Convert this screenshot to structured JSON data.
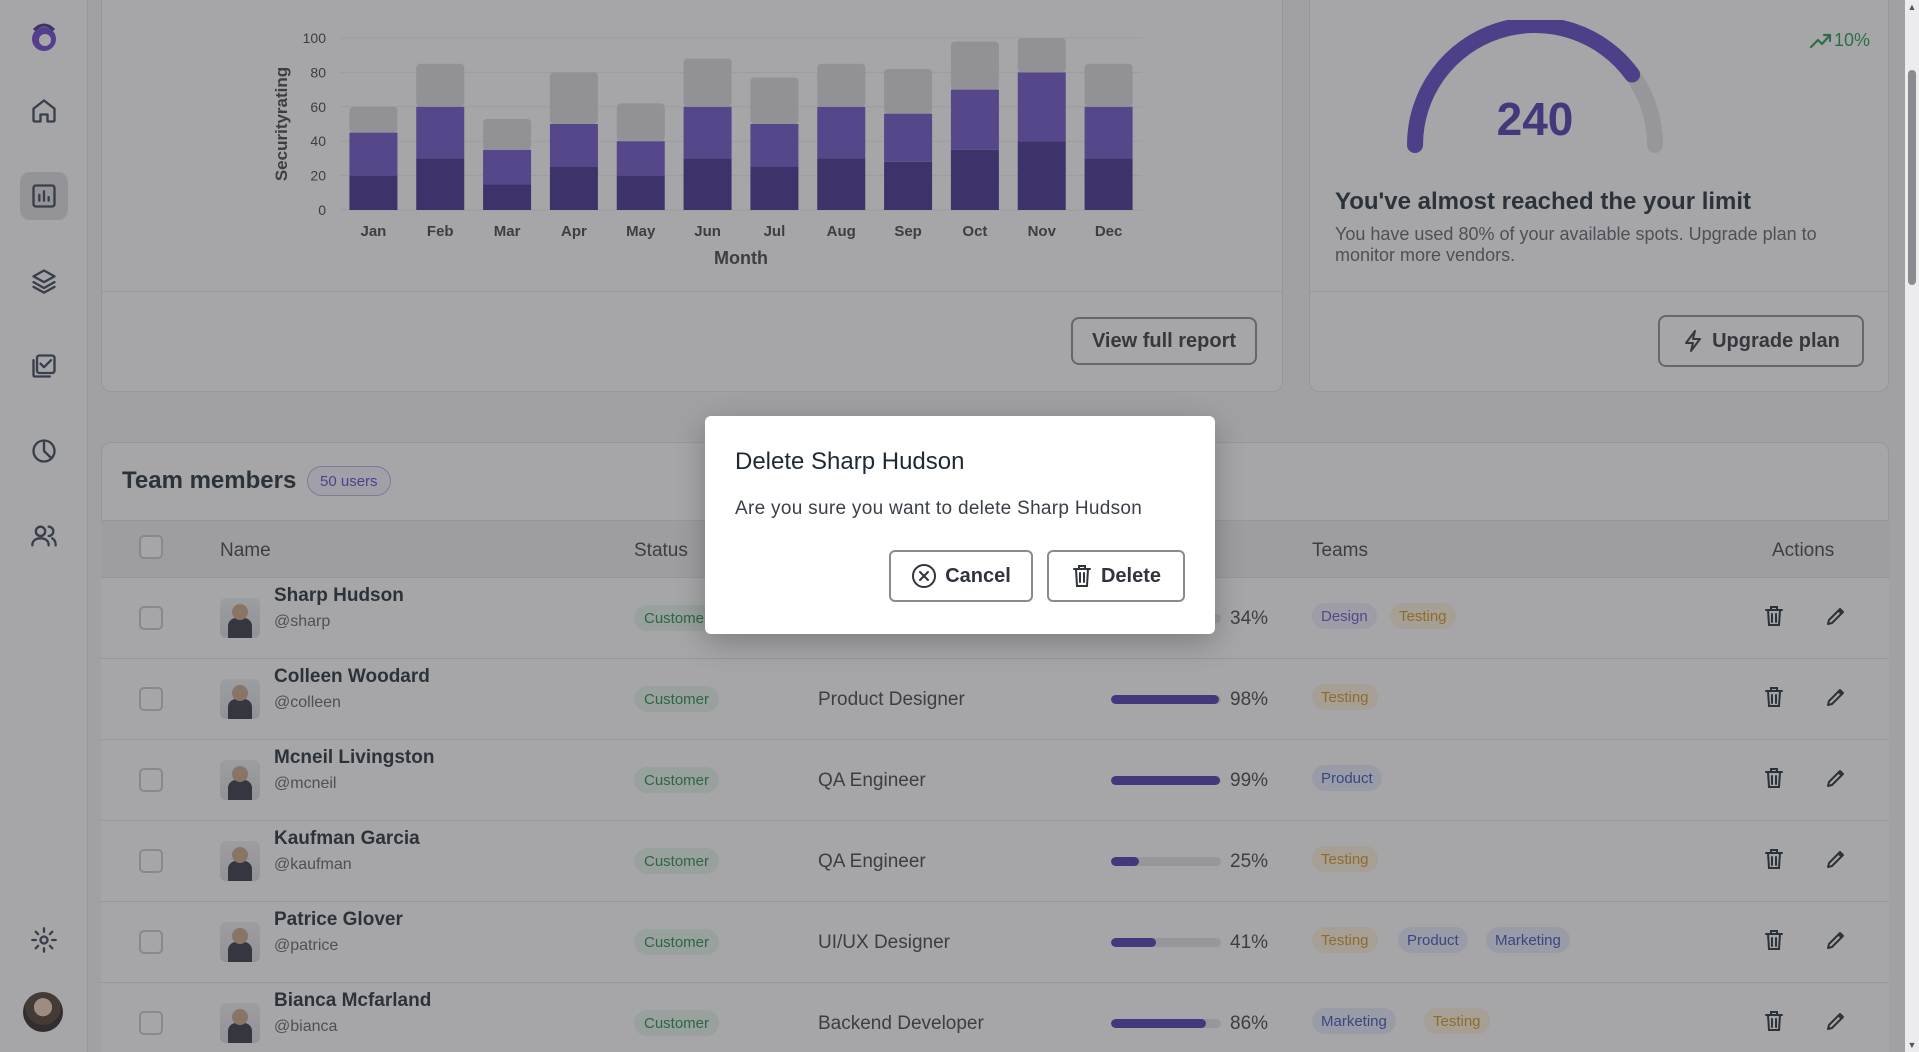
{
  "chart_data": {
    "type": "bar",
    "title": "",
    "xlabel": "Month",
    "ylabel": "Securityrating",
    "ylim": [
      0,
      100
    ],
    "yticks": [
      0,
      20,
      40,
      60,
      80,
      100
    ],
    "grid": true,
    "categories": [
      "Jan",
      "Feb",
      "Mar",
      "Apr",
      "May",
      "Jun",
      "Jul",
      "Aug",
      "Sep",
      "Oct",
      "Nov",
      "Dec"
    ],
    "stacked": true,
    "series": [
      {
        "values": [
          20,
          30,
          15,
          25,
          20,
          30,
          25,
          30,
          28,
          35,
          40,
          30
        ],
        "color": "#3f2a8c"
      },
      {
        "values": [
          25,
          30,
          20,
          25,
          20,
          30,
          25,
          30,
          28,
          35,
          40,
          30
        ],
        "color": "#6b4fc8"
      },
      {
        "values": [
          15,
          25,
          18,
          30,
          22,
          28,
          27,
          25,
          26,
          28,
          20,
          25
        ],
        "color": "#d9d9de"
      }
    ]
  },
  "chart_card": {
    "view_report_label": "View full report"
  },
  "limit_card": {
    "gauge_value": "240",
    "gauge_fraction": 0.8,
    "trend": "10%",
    "title": "You've almost reached the your limit",
    "text": "You have used 80% of your available spots. Upgrade plan to monitor more vendors.",
    "upgrade_label": "Upgrade plan"
  },
  "team": {
    "title": "Team members",
    "count_badge": "50 users",
    "columns": {
      "name": "Name",
      "status": "Status",
      "teams": "Teams",
      "actions": "Actions"
    },
    "rows": [
      {
        "name": "Sharp Hudson",
        "handle": "@sharp",
        "status": "Customer",
        "role": "",
        "progress": 34,
        "progress_text": "34%",
        "tags": [
          {
            "label": "Design",
            "kind": "design"
          },
          {
            "label": "Testing",
            "kind": "testing"
          }
        ]
      },
      {
        "name": "Colleen Woodard",
        "handle": "@colleen",
        "status": "Customer",
        "role": "Product Designer",
        "progress": 98,
        "progress_text": "98%",
        "tags": [
          {
            "label": "Testing",
            "kind": "testing"
          }
        ]
      },
      {
        "name": "Mcneil Livingston",
        "handle": "@mcneil",
        "status": "Customer",
        "role": "QA Engineer",
        "progress": 99,
        "progress_text": "99%",
        "tags": [
          {
            "label": "Product",
            "kind": "product"
          }
        ]
      },
      {
        "name": "Kaufman Garcia",
        "handle": "@kaufman",
        "status": "Customer",
        "role": "QA Engineer",
        "progress": 25,
        "progress_text": "25%",
        "tags": [
          {
            "label": "Testing",
            "kind": "testing"
          }
        ]
      },
      {
        "name": "Patrice Glover",
        "handle": "@patrice",
        "status": "Customer",
        "role": "UI/UX Designer",
        "progress": 41,
        "progress_text": "41%",
        "tags": [
          {
            "label": "Testing",
            "kind": "testing"
          },
          {
            "label": "Product",
            "kind": "product"
          },
          {
            "label": "Marketing",
            "kind": "marketing"
          }
        ]
      },
      {
        "name": "Bianca Mcfarland",
        "handle": "@bianca",
        "status": "Customer",
        "role": "Backend Developer",
        "progress": 86,
        "progress_text": "86%",
        "tags": [
          {
            "label": "Marketing",
            "kind": "marketing"
          },
          {
            "label": "Testing",
            "kind": "testing"
          }
        ]
      }
    ]
  },
  "modal": {
    "title": "Delete Sharp Hudson",
    "text": "Are you sure you want to delete Sharp Hudson",
    "cancel_label": "Cancel",
    "delete_label": "Delete"
  },
  "sidebar": {
    "items": [
      "logo",
      "home-icon",
      "bar-chart-icon",
      "layers-icon",
      "check-square-icon",
      "pie-chart-icon",
      "users-icon",
      "settings-icon",
      "avatar"
    ],
    "active_item": "bar-chart-icon"
  },
  "colors": {
    "accent": "#4a35b0",
    "success": "#1e8a43",
    "overlay": "rgba(60,60,66,0.46)"
  }
}
